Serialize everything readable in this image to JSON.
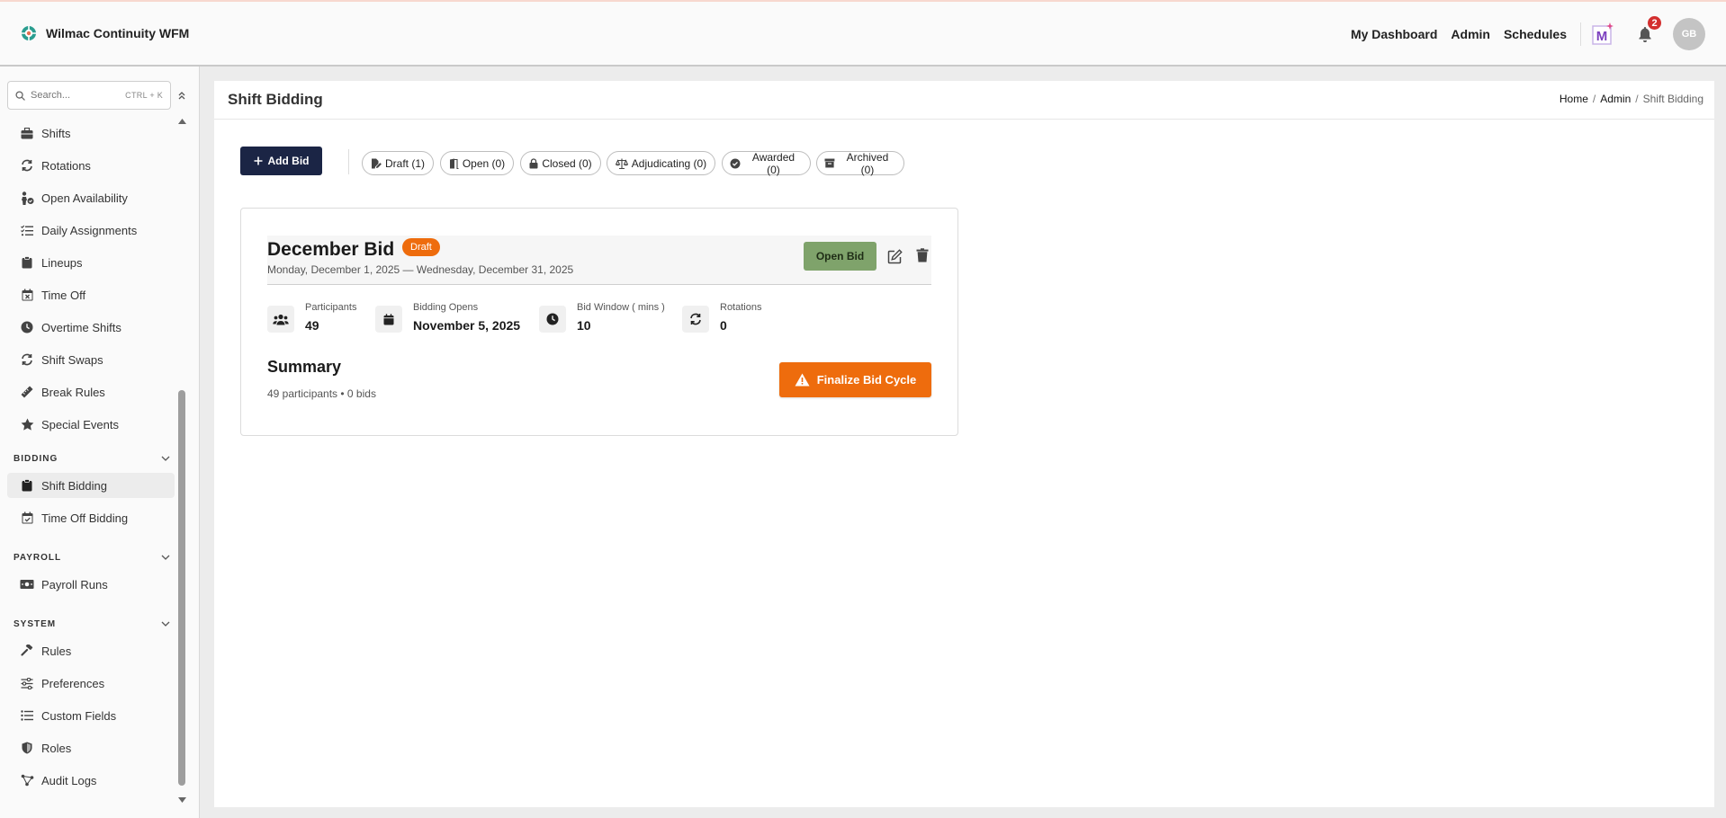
{
  "app": {
    "name": "Wilmac Continuity WFM"
  },
  "topnav": {
    "links": [
      "My Dashboard",
      "Admin",
      "Schedules"
    ],
    "notification_count": "2",
    "avatar_initials": "GB"
  },
  "sidebar": {
    "search_placeholder": "Search...",
    "search_shortcut": "CTRL + K",
    "items": [
      {
        "label": "Shifts",
        "icon": "briefcase-icon"
      },
      {
        "label": "Rotations",
        "icon": "rotate-icon"
      },
      {
        "label": "Open Availability",
        "icon": "person-check-icon"
      },
      {
        "label": "Daily Assignments",
        "icon": "checklist-icon"
      },
      {
        "label": "Lineups",
        "icon": "clipboard-icon"
      },
      {
        "label": "Time Off",
        "icon": "calendar-x-icon"
      },
      {
        "label": "Overtime Shifts",
        "icon": "clock-icon"
      },
      {
        "label": "Shift Swaps",
        "icon": "swap-icon"
      },
      {
        "label": "Break Rules",
        "icon": "ruler-icon"
      },
      {
        "label": "Special Events",
        "icon": "star-icon"
      }
    ],
    "sections": {
      "bidding": {
        "title": "BIDDING",
        "items": [
          "Shift Bidding",
          "Time Off Bidding"
        ]
      },
      "payroll": {
        "title": "PAYROLL",
        "items": [
          "Payroll Runs"
        ]
      },
      "system": {
        "title": "SYSTEM",
        "items": [
          "Rules",
          "Preferences",
          "Custom Fields",
          "Roles",
          "Audit Logs"
        ]
      }
    }
  },
  "page": {
    "title": "Shift Bidding",
    "breadcrumb": [
      "Home",
      "Admin",
      "Shift Bidding"
    ],
    "add_bid_label": "Add Bid",
    "filters": [
      {
        "label": "Draft (1)"
      },
      {
        "label": "Open (0)"
      },
      {
        "label": "Closed (0)"
      },
      {
        "label": "Adjudicating (0)"
      },
      {
        "label": "Awarded (0)"
      },
      {
        "label": "Archived (0)"
      }
    ]
  },
  "bid": {
    "title": "December Bid",
    "status": "Draft",
    "date_range": "Monday, December 1, 2025 — Wednesday, December 31, 2025",
    "open_bid_label": "Open Bid",
    "stats": [
      {
        "label": "Participants",
        "value": "49"
      },
      {
        "label": "Bidding Opens",
        "value": "November 5, 2025"
      },
      {
        "label": "Bid Window ( mins )",
        "value": "10"
      },
      {
        "label": "Rotations",
        "value": "0"
      }
    ],
    "summary_title": "Summary",
    "summary_text": "49 participants • 0 bids",
    "finalize_label": "Finalize Bid Cycle"
  },
  "colors": {
    "primary": "#1b2545",
    "accent_orange": "#ee6c0d",
    "open_bid_green": "#7fa36b",
    "notification_red": "#d32f2f"
  }
}
